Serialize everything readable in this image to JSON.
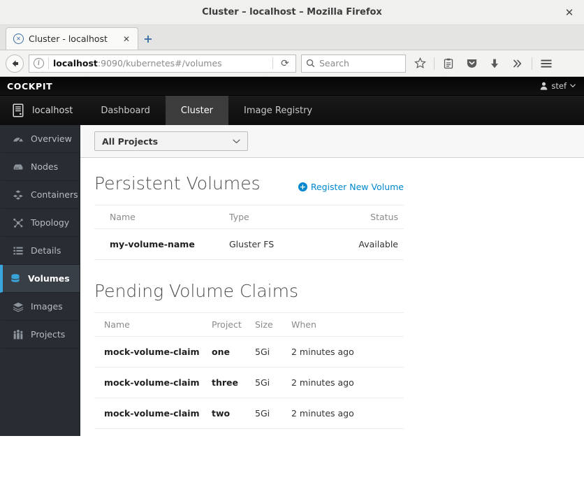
{
  "browser": {
    "window_title": "Cluster – localhost – Mozilla Firefox",
    "close_label": "✕",
    "tab": {
      "label": "Cluster - localhost",
      "favicon_name": "generic-page-favicon",
      "close_label": "✕"
    },
    "new_tab_label": "+",
    "url": {
      "host": "localhost",
      "path": ":9090/kubernetes#/volumes",
      "full": "localhost:9090/kubernetes#/volumes"
    },
    "search_placeholder": "Search",
    "toolbar_icons": [
      "bookmark-star-icon",
      "reader-list-icon",
      "pocket-icon",
      "downloads-icon",
      "overflow-chevron-icon",
      "hamburger-menu-icon"
    ]
  },
  "cockpit": {
    "brand": "COCKPIT",
    "user": "stef",
    "host": "localhost",
    "nav_tabs": [
      {
        "label": "Dashboard",
        "active": false
      },
      {
        "label": "Cluster",
        "active": true
      },
      {
        "label": "Image Registry",
        "active": false
      }
    ],
    "sidebar": {
      "items": [
        {
          "label": "Overview",
          "icon": "gauge-icon",
          "active": false
        },
        {
          "label": "Nodes",
          "icon": "server-icon",
          "active": false
        },
        {
          "label": "Containers",
          "icon": "cubes-icon",
          "active": false
        },
        {
          "label": "Topology",
          "icon": "topology-icon",
          "active": false
        },
        {
          "label": "Details",
          "icon": "list-icon",
          "active": false
        },
        {
          "label": "Volumes",
          "icon": "database-icon",
          "active": true
        },
        {
          "label": "Images",
          "icon": "layers-icon",
          "active": false
        },
        {
          "label": "Projects",
          "icon": "people-icon",
          "active": false
        }
      ]
    },
    "filter": {
      "project_selected": "All Projects",
      "chevron": "chevron-down-icon"
    },
    "persistent_volumes": {
      "title": "Persistent Volumes",
      "register_link": "Register New Volume",
      "columns": [
        "Name",
        "Type",
        "Status"
      ],
      "rows": [
        {
          "name": "my-volume-name",
          "type": "Gluster FS",
          "status": "Available"
        }
      ]
    },
    "pending_claims": {
      "title": "Pending Volume Claims",
      "columns": [
        "Name",
        "Project",
        "Size",
        "When"
      ],
      "rows": [
        {
          "name": "mock-volume-claim",
          "project": "one",
          "size": "5Gi",
          "when": "2 minutes ago"
        },
        {
          "name": "mock-volume-claim",
          "project": "three",
          "size": "5Gi",
          "when": "2 minutes ago"
        },
        {
          "name": "mock-volume-claim",
          "project": "two",
          "size": "5Gi",
          "when": "2 minutes ago"
        }
      ]
    }
  },
  "colors": {
    "accent_blue": "#0088ce",
    "sidebar_active_blue": "#39a5dc",
    "sidebar_bg": "#292d33",
    "nav_bg": "#1a1a1a"
  }
}
